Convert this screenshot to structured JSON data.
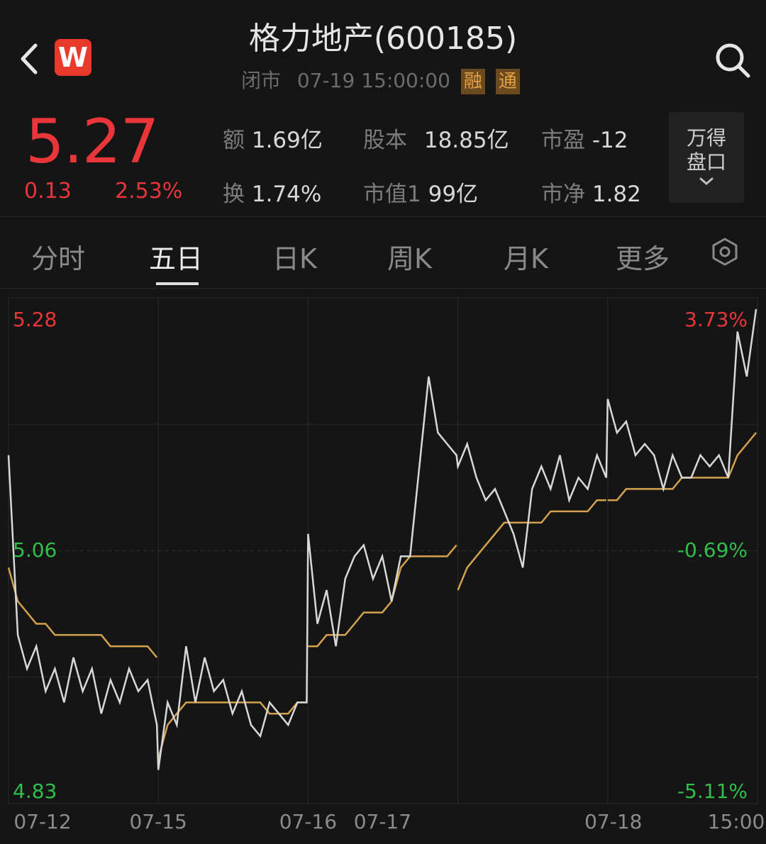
{
  "header": {
    "title": "格力地产(600185)",
    "status": "闭市",
    "datetime": "07-19 15:00:00",
    "tags": [
      "融",
      "通"
    ],
    "logo_letter": "W"
  },
  "quote": {
    "price": "5.27",
    "change": "0.13",
    "change_pct": "2.53%",
    "stats": [
      {
        "label": "额",
        "value": "1.69亿"
      },
      {
        "label": "股本",
        "value": "18.85亿"
      },
      {
        "label": "市盈",
        "value": "-12"
      },
      {
        "label": "换",
        "value": "1.74%"
      },
      {
        "label": "市值1",
        "value": "99亿"
      },
      {
        "label": "市净",
        "value": "1.82"
      }
    ],
    "wind_button": [
      "万得",
      "盘口"
    ]
  },
  "tabs": [
    {
      "label": "分时",
      "active": false
    },
    {
      "label": "五日",
      "active": true
    },
    {
      "label": "日K",
      "active": false
    },
    {
      "label": "周K",
      "active": false
    },
    {
      "label": "月K",
      "active": false
    },
    {
      "label": "更多",
      "active": false
    }
  ],
  "colors": {
    "up": "#e8363a",
    "down": "#2fbf4a",
    "price_line": "#d8d8d8",
    "avg_line": "#d4a24c",
    "grid": "#2c2c2c"
  },
  "chart_data": {
    "type": "line",
    "title": "",
    "ylim": [
      4.83,
      5.28
    ],
    "y_tick_labels_left": [
      "5.28",
      "5.06",
      "4.83"
    ],
    "y_tick_labels_right": [
      "3.73%",
      "-0.69%",
      "-5.11%"
    ],
    "x_tick_labels": [
      "07-12",
      "07-15",
      "07-16",
      "07-17",
      "07-18",
      "15:00"
    ],
    "days": [
      "07-12",
      "07-15",
      "07-16",
      "07-17",
      "07-18"
    ],
    "series": [
      {
        "values": [
          [
            5.14,
            4.98,
            4.95,
            4.97,
            4.93,
            4.95,
            4.92,
            4.96,
            4.93,
            4.95,
            4.91,
            4.94,
            4.92,
            4.95,
            4.93,
            4.94,
            4.9
          ],
          [
            4.86,
            4.92,
            4.9,
            4.97,
            4.92,
            4.96,
            4.93,
            4.94,
            4.91,
            4.93,
            4.9,
            4.89,
            4.92,
            4.91,
            4.9,
            4.92,
            4.92
          ],
          [
            5.07,
            4.99,
            5.02,
            4.97,
            5.03,
            5.05,
            5.06,
            5.03,
            5.05,
            5.01,
            5.05,
            5.05,
            5.13,
            5.21,
            5.16,
            5.15,
            5.14
          ],
          [
            5.13,
            5.15,
            5.12,
            5.1,
            5.11,
            5.09,
            5.07,
            5.04,
            5.11,
            5.13,
            5.11,
            5.14,
            5.1,
            5.12,
            5.11,
            5.14,
            5.12
          ],
          [
            5.19,
            5.16,
            5.17,
            5.14,
            5.15,
            5.14,
            5.11,
            5.14,
            5.12,
            5.12,
            5.14,
            5.13,
            5.14,
            5.12,
            5.25,
            5.21,
            5.27
          ]
        ]
      },
      {
        "values": [
          [
            5.04,
            5.01,
            5.0,
            4.99,
            4.99,
            4.98,
            4.98,
            4.98,
            4.98,
            4.98,
            4.98,
            4.97,
            4.97,
            4.97,
            4.97,
            4.97,
            4.96
          ],
          [
            4.87,
            4.9,
            4.91,
            4.92,
            4.92,
            4.92,
            4.92,
            4.92,
            4.92,
            4.92,
            4.92,
            4.92,
            4.91,
            4.91,
            4.91,
            4.92,
            4.92
          ],
          [
            4.97,
            4.97,
            4.98,
            4.98,
            4.98,
            4.99,
            5.0,
            5.0,
            5.0,
            5.01,
            5.04,
            5.05,
            5.05,
            5.05,
            5.05,
            5.05,
            5.06
          ],
          [
            5.02,
            5.04,
            5.05,
            5.06,
            5.07,
            5.08,
            5.08,
            5.08,
            5.08,
            5.08,
            5.09,
            5.09,
            5.09,
            5.09,
            5.09,
            5.1,
            5.1
          ],
          [
            5.1,
            5.1,
            5.11,
            5.11,
            5.11,
            5.11,
            5.11,
            5.11,
            5.12,
            5.12,
            5.12,
            5.12,
            5.12,
            5.12,
            5.14,
            5.15,
            5.16
          ]
        ]
      }
    ],
    "grid": true
  }
}
